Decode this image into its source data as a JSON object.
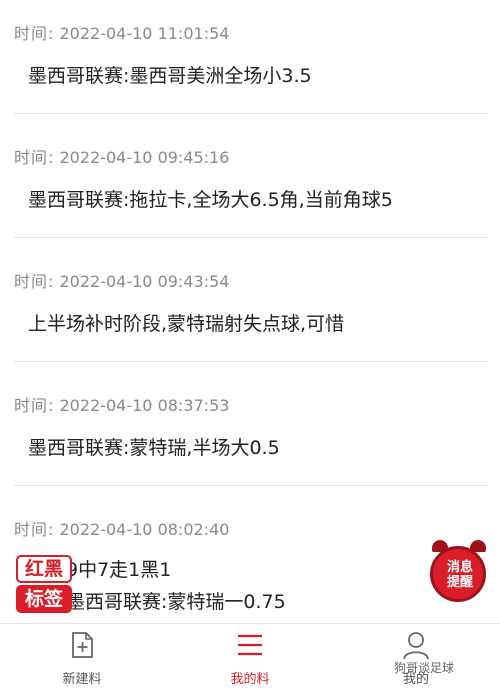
{
  "colors": {
    "accent": "#d91e2a",
    "muted": "#8a8a8a",
    "divider": "#e6e6e6"
  },
  "time_label": "时间:",
  "feed": [
    {
      "time": "2022-04-10 11:01:54",
      "text": "墨西哥联赛:墨西哥美洲全场小3.5"
    },
    {
      "time": "2022-04-10 09:45:16",
      "text": "墨西哥联赛:拖拉卡,全场大6.5角,当前角球5"
    },
    {
      "time": "2022-04-10 09:43:54",
      "text": "上半场补时阶段,蒙特瑞射失点球,可惜"
    },
    {
      "time": "2022-04-10 08:37:53",
      "text": "墨西哥联赛:蒙特瑞,半场大0.5"
    },
    {
      "time": "2022-04-10 08:02:40",
      "text": "么推9中7走1黑1",
      "text2": "推荐墨西哥联赛:蒙特瑞一0.75"
    }
  ],
  "badge": {
    "line1": "红黑",
    "line2": "标签"
  },
  "reminder": {
    "line1": "消息",
    "line2": "提醒"
  },
  "tabs": [
    {
      "label": "新建料",
      "icon": "new-document-icon"
    },
    {
      "label": "我的料",
      "icon": "list-menu-icon",
      "active": true
    },
    {
      "label": "我的",
      "icon": "profile-icon"
    }
  ],
  "watermark": "狗哥谈足球"
}
